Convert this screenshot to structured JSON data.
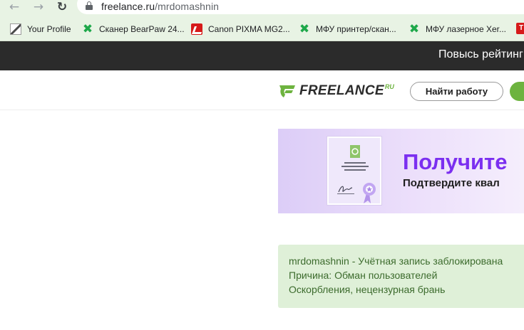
{
  "browser": {
    "url_host": "freelance.ru",
    "url_path": "/mrdomashnin",
    "nav": {
      "back_icon": "arrow-left-icon",
      "forward_icon": "arrow-right-icon",
      "reload_icon": "reload-icon"
    }
  },
  "bookmarks": [
    {
      "label": "Your Profile",
      "icon": "profile-favicon"
    },
    {
      "label": "Сканер BearPaw 24...",
      "icon": "green-x-favicon"
    },
    {
      "label": "Canon PIXMA MG2...",
      "icon": "canon-favicon"
    },
    {
      "label": "МФУ принтер/скан...",
      "icon": "green-x-favicon"
    },
    {
      "label": "МФУ лазерное Xer...",
      "icon": "green-x-favicon"
    }
  ],
  "top_strip": {
    "promo": "Повысь рейтинг"
  },
  "header": {
    "logo_word": "FREELANCE",
    "logo_suffix": "RU",
    "find_work": "Найти работу",
    "accent_color": "#6db33f"
  },
  "banner": {
    "heading": "Получите",
    "subheading": "Подтвердите квал",
    "heading_color": "#7b2ff0"
  },
  "notice": {
    "line1": "mrdomashnin - Учётная запись заблокирована",
    "line2": "Причина: Обман пользователей",
    "line3": "Оскорбления, нецензурная брань"
  }
}
